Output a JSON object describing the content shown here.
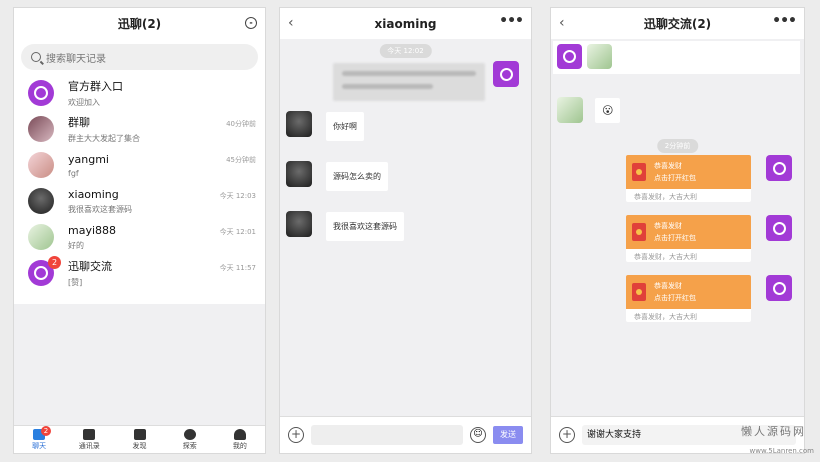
{
  "list": {
    "title": "迅聊(2)",
    "search_placeholder": "搜索聊天记录",
    "items": [
      {
        "name": "官方群入口",
        "preview": "欢迎加入",
        "time": ""
      },
      {
        "name": "群聊",
        "preview": "群主大大发起了集合",
        "time": "40分钟前"
      },
      {
        "name": "yangmi",
        "preview": "fgf",
        "time": "45分钟前"
      },
      {
        "name": "xiaoming",
        "preview": "我很喜欢这套源码",
        "time": "今天 12:03"
      },
      {
        "name": "mayi888",
        "preview": "好的",
        "time": "今天 12:01"
      },
      {
        "name": "迅聊交流",
        "preview": "[赞]",
        "time": "今天 11:57",
        "badge": "2"
      }
    ],
    "nav": [
      {
        "label": "聊天",
        "badge": "2"
      },
      {
        "label": "通讯录"
      },
      {
        "label": "发现"
      },
      {
        "label": "探索"
      },
      {
        "label": "我的"
      }
    ]
  },
  "chat": {
    "title": "xiaoming",
    "timestamp": "今天 12:02",
    "messages": [
      "你好啊",
      "源码怎么卖的",
      "我很喜欢这套源码"
    ],
    "send": "发送"
  },
  "group": {
    "title": "迅聊交流(2)",
    "timestamp": "2分钟前",
    "redpacket": {
      "line1": "恭喜发财",
      "line2": "点击打开红包",
      "footer": "恭喜发财，大吉大利"
    },
    "input_value": "谢谢大家支持",
    "emoji": "😮"
  },
  "watermark": {
    "main": "懒人源码网",
    "url": "www.5Lanren.com"
  },
  "colors": {
    "brand": "#a23ad6",
    "accent": "#2a7fe0",
    "redpacket": "#f5a14a",
    "send": "#8a8cf0"
  }
}
